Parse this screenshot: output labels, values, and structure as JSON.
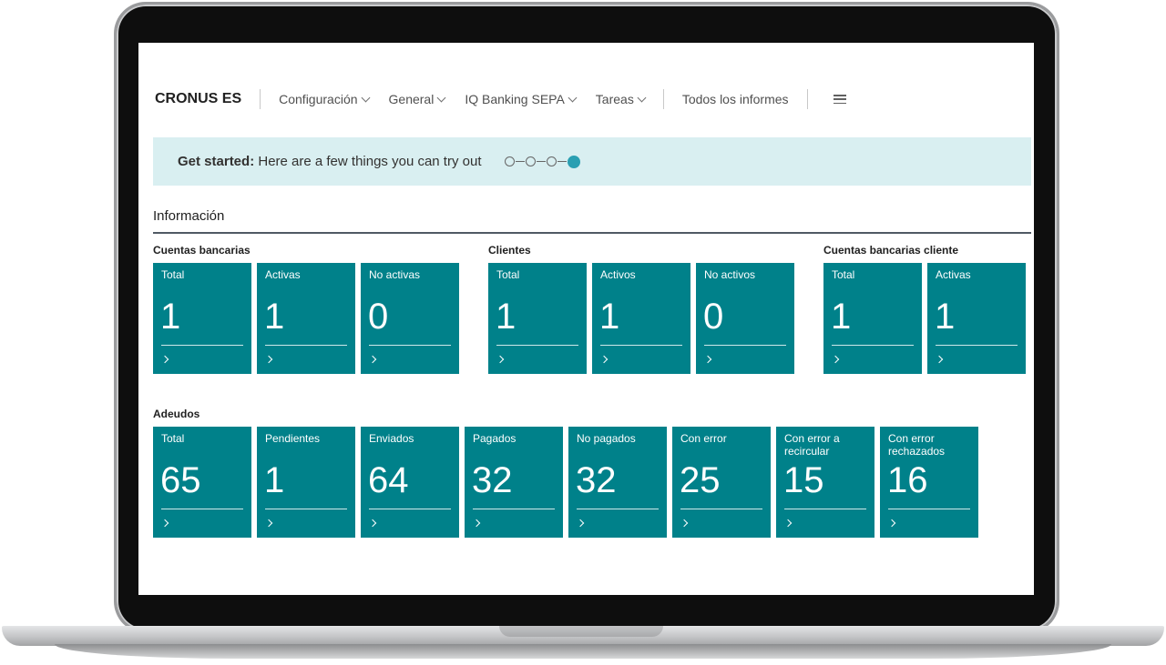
{
  "nav": {
    "company": "CRONUS ES",
    "menus": [
      "Configuración",
      "General",
      "IQ Banking SEPA",
      "Tareas"
    ],
    "reports": "Todos los informes",
    "more_icon": "hamburger-icon"
  },
  "banner": {
    "lead": "Get started:",
    "text": " Here are a few things you can try out",
    "steps_total": 4,
    "steps_current": 4
  },
  "section": {
    "title": "Información"
  },
  "groups": {
    "cuentas": {
      "label": "Cuentas bancarias",
      "tiles": [
        {
          "label": "Total",
          "value": "1"
        },
        {
          "label": "Activas",
          "value": "1"
        },
        {
          "label": "No activas",
          "value": "0"
        }
      ]
    },
    "clientes": {
      "label": "Clientes",
      "tiles": [
        {
          "label": "Total",
          "value": "1"
        },
        {
          "label": "Activos",
          "value": "1"
        },
        {
          "label": "No activos",
          "value": "0"
        }
      ]
    },
    "cuentas_cliente": {
      "label": "Cuentas bancarias cliente",
      "tiles": [
        {
          "label": "Total",
          "value": "1"
        },
        {
          "label": "Activas",
          "value": "1"
        }
      ]
    },
    "adeudos": {
      "label": "Adeudos",
      "tiles": [
        {
          "label": "Total",
          "value": "65"
        },
        {
          "label": "Pendientes",
          "value": "1"
        },
        {
          "label": "Enviados",
          "value": "64"
        },
        {
          "label": "Pagados",
          "value": "32"
        },
        {
          "label": "No pagados",
          "value": "32"
        },
        {
          "label": "Con error",
          "value": "25"
        },
        {
          "label": "Con error a recircular",
          "value": "15"
        },
        {
          "label": "Con error rechazados",
          "value": "16"
        }
      ]
    }
  },
  "colors": {
    "tile": "#00818a",
    "banner": "#d9eff1",
    "step_active": "#2a9fb2"
  }
}
